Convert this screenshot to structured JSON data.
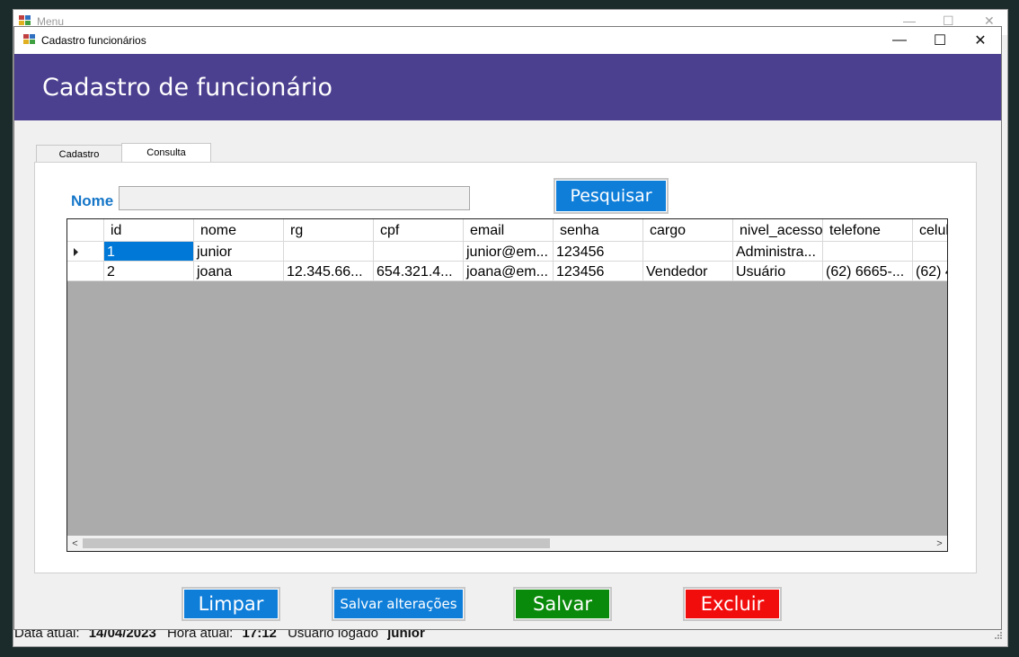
{
  "menu_window": {
    "title": "Menu",
    "minimize": "—",
    "maximize": "☐",
    "close": "✕"
  },
  "dialog": {
    "title": "Cadastro funcionários",
    "minimize": "—",
    "maximize": "☐",
    "close": "✕",
    "banner_title": "Cadastro de funcionário"
  },
  "tabs": [
    {
      "label": "Cadastro"
    },
    {
      "label": "Consulta"
    }
  ],
  "search": {
    "label": "Nome",
    "value": "",
    "button_label": "Pesquisar"
  },
  "grid": {
    "columns": [
      "id",
      "nome",
      "rg",
      "cpf",
      "email",
      "senha",
      "cargo",
      "nivel_acesso",
      "telefone",
      "celul"
    ],
    "rows": [
      [
        "1",
        "junior",
        "",
        "",
        "junior@em...",
        "123456",
        "",
        "Administra...",
        "",
        ""
      ],
      [
        "2",
        "joana",
        "12.345.66...",
        "654.321.4...",
        "joana@em...",
        "123456",
        "Vendedor",
        "Usuário",
        "(62) 6665-...",
        "(62) 4"
      ]
    ],
    "scroll_left": "<",
    "scroll_right": ">"
  },
  "actions": {
    "limpar": "Limpar",
    "salvar_alteracoes": "Salvar alterações",
    "salvar": "Salvar",
    "excluir": "Excluir"
  },
  "colors": {
    "banner": "#4b3f8f",
    "primary_button": "#0f7ed9",
    "save_button": "#0a8a0a",
    "delete_button": "#f20d0d",
    "label_blue": "#1576c8"
  },
  "status": {
    "date_label": "Data atual:",
    "date_value": "14/04/2023",
    "time_label": "Hora atual:",
    "time_value": "17:12",
    "user_label": "Usuário logado",
    "user_value": "junior"
  }
}
